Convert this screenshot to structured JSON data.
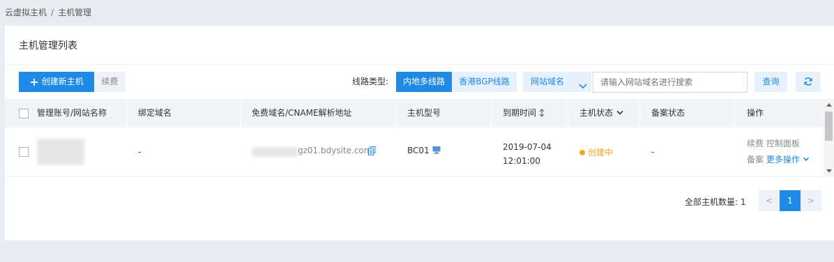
{
  "breadcrumb": {
    "parent": "云虚拟主机",
    "separator": "/",
    "current": "主机管理"
  },
  "panel": {
    "title": "主机管理列表"
  },
  "toolbar": {
    "create_label": "创建新主机",
    "renew_label": "续费",
    "line_type_label": "线路类型:",
    "line_options": [
      "内地多线路",
      "香港BGP线路"
    ],
    "line_selected": "内地多线路",
    "search_field_select": "网站域名",
    "search_placeholder": "请输入网站域名进行搜索",
    "query_label": "查询",
    "refresh_icon": "refresh-icon"
  },
  "table": {
    "headers": {
      "account": "管理账号/网站名称",
      "domain": "绑定域名",
      "cname": "免费域名/CNAME解析地址",
      "model": "主机型号",
      "expire": "到期时间",
      "status": "主机状态",
      "filing": "备案状态",
      "ops": "操作"
    },
    "rows": [
      {
        "domain": "-",
        "cname": "gz01.bdysite.com",
        "model": "BC01",
        "expire_date": "2019-07-04",
        "expire_time": "12:01:00",
        "status": "创建中",
        "filing": "-",
        "ops": {
          "renew": "续费",
          "control": "控制面板",
          "filing": "备案",
          "more": "更多操作"
        }
      }
    ]
  },
  "pagination": {
    "total_label": "全部主机数量:",
    "total_count": "1",
    "prev": "<",
    "current": "1",
    "next": ">"
  },
  "colors": {
    "accent": "#1f8ae6",
    "status_creating": "#f5a623"
  }
}
